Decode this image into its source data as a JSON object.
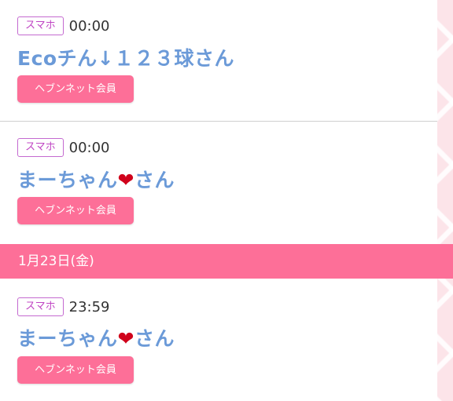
{
  "entries": [
    {
      "device": "スマホ",
      "time": "00:00",
      "name": "Eco チん↓１２３球さん",
      "name_parts": {
        "before": "Ecoチん↓１２３球さん",
        "heart": "",
        "after": ""
      },
      "button": "ヘブンネット会員"
    },
    {
      "device": "スマホ",
      "time": "00:00",
      "name_parts": {
        "before": "まーちゃん",
        "heart": "❤",
        "after": "さん"
      },
      "button": "ヘブンネット会員"
    },
    {
      "device": "スマホ",
      "time": "23:59",
      "name_parts": {
        "before": "まーちゃん",
        "heart": "❤",
        "after": "さん"
      },
      "button": "ヘブンネット会員"
    }
  ],
  "date_header": "1月23日(金)",
  "colors": {
    "accent_pink": "#fd6f98",
    "name_blue": "#6b9ad8",
    "badge_purple": "#c046c4",
    "heart_red": "#d0021b"
  }
}
